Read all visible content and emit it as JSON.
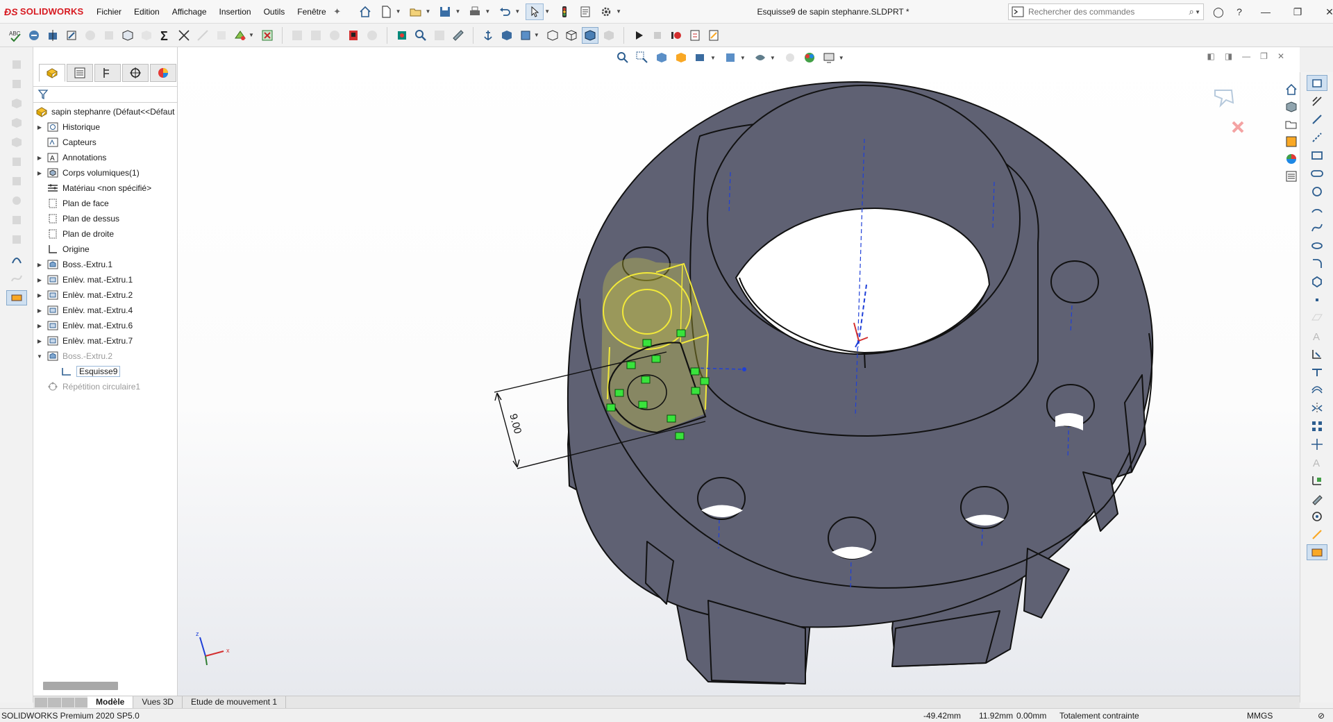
{
  "app": {
    "brand": "SOLIDWORKS",
    "brand_color": "#d71920"
  },
  "menu": [
    "Fichier",
    "Edition",
    "Affichage",
    "Insertion",
    "Outils",
    "Fenêtre"
  ],
  "document_title": "Esquisse9 de sapin stephanre.SLDPRT *",
  "search": {
    "placeholder": "Rechercher des commandes"
  },
  "feature_tree": {
    "root": "sapin stephanre  (Défaut<<Défaut",
    "nodes": [
      {
        "label": "Historique",
        "icon": "history-icon",
        "expandable": true
      },
      {
        "label": "Capteurs",
        "icon": "sensor-icon",
        "expandable": false
      },
      {
        "label": "Annotations",
        "icon": "annotation-icon",
        "expandable": true
      },
      {
        "label": "Corps volumiques(1)",
        "icon": "solid-bodies-icon",
        "expandable": true
      },
      {
        "label": "Matériau <non spécifié>",
        "icon": "material-icon",
        "expandable": false
      },
      {
        "label": "Plan de face",
        "icon": "plane-icon",
        "expandable": false
      },
      {
        "label": "Plan de dessus",
        "icon": "plane-icon",
        "expandable": false
      },
      {
        "label": "Plan de droite",
        "icon": "plane-icon",
        "expandable": false
      },
      {
        "label": "Origine",
        "icon": "origin-icon",
        "expandable": false
      },
      {
        "label": "Boss.-Extru.1",
        "icon": "extrude-icon",
        "expandable": true
      },
      {
        "label": "Enlèv. mat.-Extru.1",
        "icon": "cut-extrude-icon",
        "expandable": true
      },
      {
        "label": "Enlèv. mat.-Extru.2",
        "icon": "cut-extrude-icon",
        "expandable": true
      },
      {
        "label": "Enlèv. mat.-Extru.4",
        "icon": "cut-extrude-icon",
        "expandable": true
      },
      {
        "label": "Enlèv. mat.-Extru.6",
        "icon": "cut-extrude-icon",
        "expandable": true
      },
      {
        "label": "Enlèv. mat.-Extru.7",
        "icon": "cut-extrude-icon",
        "expandable": true
      },
      {
        "label": "Boss.-Extru.2",
        "icon": "extrude-icon",
        "expandable": true,
        "expanded": true,
        "grey": true
      },
      {
        "label": "Esquisse9",
        "icon": "sketch-icon",
        "expandable": false,
        "child": true,
        "selected": true
      },
      {
        "label": "Répétition circulaire1",
        "icon": "circular-pattern-icon",
        "expandable": false,
        "grey": true
      }
    ]
  },
  "viewport": {
    "dimension_label": "9.00",
    "model_color": "#5f6173",
    "sketch_color": "#f2e93a"
  },
  "bottom_tabs": [
    "Modèle",
    "Vues 3D",
    "Etude de mouvement 1"
  ],
  "status": {
    "product": "SOLIDWORKS Premium 2020 SP5.0",
    "x": "-49.42mm",
    "y": "11.92mm",
    "z": "0.00mm",
    "sketch_state": "Totalement contrainte",
    "units": "MMGS"
  }
}
